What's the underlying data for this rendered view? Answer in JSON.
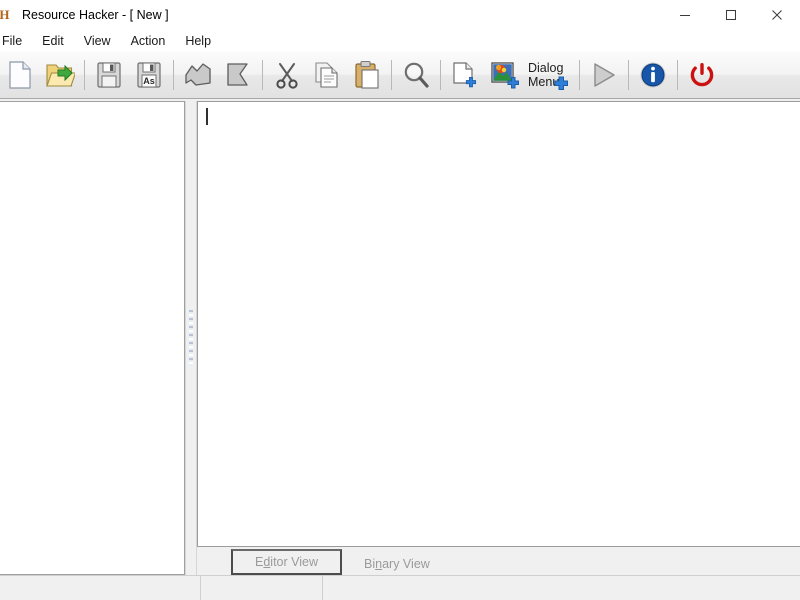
{
  "window": {
    "app_name": "Resource Hacker",
    "title": "Resource Hacker - [ New ]",
    "icon_label": "RH",
    "controls": {
      "minimize": "minimize-button",
      "maximize": "maximize-button",
      "close": "close-button"
    }
  },
  "menu": {
    "items": [
      {
        "label": "File"
      },
      {
        "label": "Edit"
      },
      {
        "label": "View"
      },
      {
        "label": "Action"
      },
      {
        "label": "Help"
      }
    ]
  },
  "toolbar": {
    "buttons": [
      {
        "name": "new-file-button",
        "icon": "new-document-icon",
        "label": "New"
      },
      {
        "name": "open-file-button",
        "icon": "open-folder-icon",
        "label": "Open"
      },
      {
        "name": "save-button",
        "icon": "save-floppy-icon",
        "label": "Save"
      },
      {
        "name": "save-as-button",
        "icon": "save-as-floppy-icon",
        "label": "Save As",
        "glyph": "As"
      },
      {
        "name": "save-resource-button",
        "icon": "save-resource-icon",
        "label": "Save Resource"
      },
      {
        "name": "replace-resource-button",
        "icon": "replace-resource-icon",
        "label": "Replace Resource"
      },
      {
        "name": "cut-button",
        "icon": "scissors-icon",
        "label": "Cut"
      },
      {
        "name": "copy-button",
        "icon": "copy-pages-icon",
        "label": "Copy"
      },
      {
        "name": "paste-button",
        "icon": "clipboard-icon",
        "label": "Paste"
      },
      {
        "name": "find-button",
        "icon": "magnifier-icon",
        "label": "Find"
      },
      {
        "name": "add-binary-resource-button",
        "icon": "add-page-plus-icon",
        "label": "Add Binary Resource"
      },
      {
        "name": "add-image-resource-button",
        "icon": "add-image-plus-icon",
        "label": "Add Image Resource"
      },
      {
        "name": "add-dialog-menu-button",
        "icon": "add-dialog-menu-icon",
        "label": "Dialog Menu",
        "glyph_line1": "Dialog",
        "glyph_line2": "Menu"
      },
      {
        "name": "compile-script-button",
        "icon": "play-triangle-icon",
        "label": "Compile Script"
      },
      {
        "name": "about-button",
        "icon": "info-circle-icon",
        "label": "About"
      },
      {
        "name": "exit-button",
        "icon": "power-icon",
        "label": "Exit"
      }
    ]
  },
  "left_panel": {
    "name": "resource-tree",
    "items": []
  },
  "editor": {
    "name": "script-editor",
    "content": "",
    "caret_visible": true
  },
  "tabs": [
    {
      "label": "Editor View",
      "accel_index": 2,
      "active": true,
      "name": "tab-editor-view"
    },
    {
      "label": "Binary View",
      "accel_index": 2,
      "active": false,
      "name": "tab-binary-view"
    }
  ],
  "tab_parts": {
    "editor": {
      "pre": "E",
      "acc": "d",
      "post": "itor View"
    },
    "binary": {
      "pre": "Bi",
      "acc": "n",
      "post": "ary View"
    }
  },
  "statusbar": {
    "cells": [
      "",
      "",
      ""
    ]
  },
  "colors": {
    "accent_blue": "#1756a9",
    "power_red": "#cc1111",
    "folder_yellow": "#f2d16b",
    "plus_blue": "#2f7fd8",
    "titlebar_bg": "#ffffff",
    "toolbar_bg": "#f0f0f0",
    "panel_bg": "#f0f0f0",
    "editor_bg": "#ffffff",
    "tab_text": "#9a9a9a"
  }
}
